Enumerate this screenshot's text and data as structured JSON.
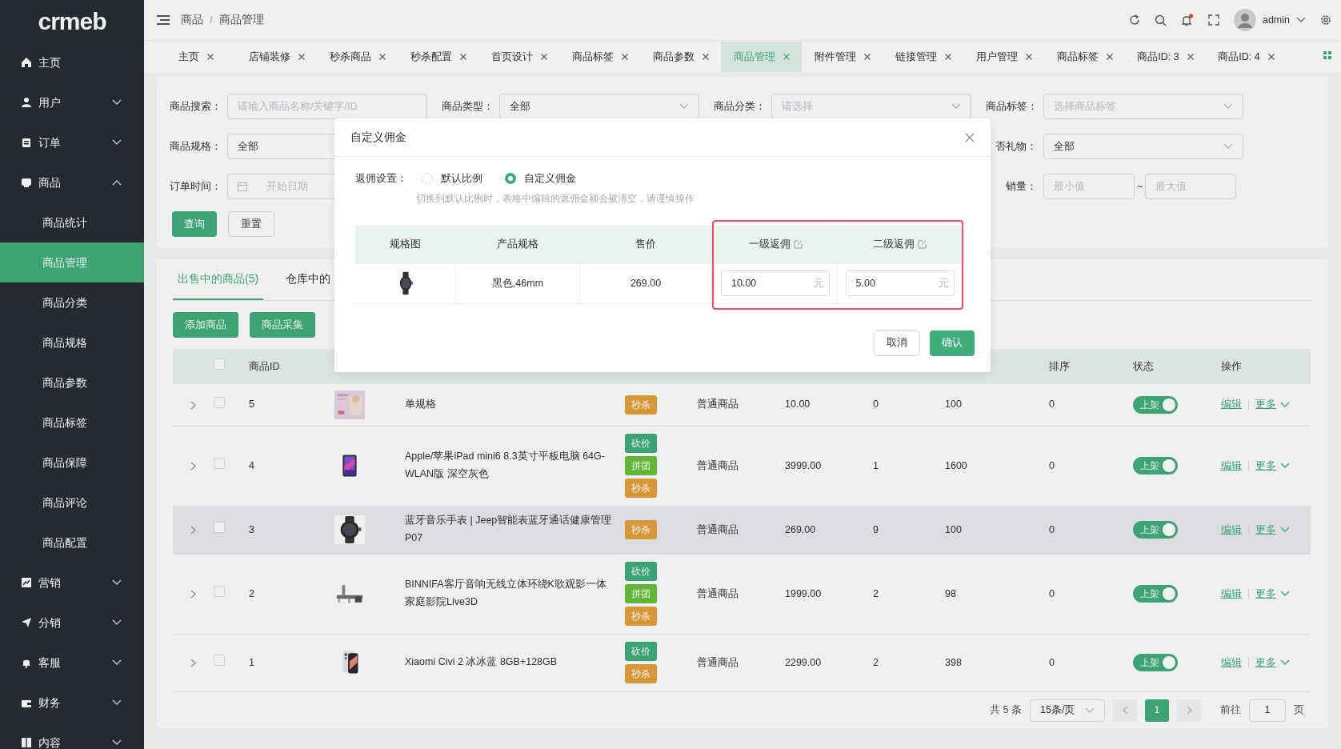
{
  "sidebar": {
    "logo": "crmeb",
    "items": [
      {
        "label": "主页"
      },
      {
        "label": "用户",
        "expanded": false
      },
      {
        "label": "订单",
        "expanded": false
      },
      {
        "label": "商品",
        "expanded": true,
        "children": [
          {
            "label": "商品统计",
            "selected": false
          },
          {
            "label": "商品管理",
            "selected": true
          },
          {
            "label": "商品分类",
            "selected": false
          },
          {
            "label": "商品规格",
            "selected": false
          },
          {
            "label": "商品参数",
            "selected": false
          },
          {
            "label": "商品标签",
            "selected": false
          },
          {
            "label": "商品保障",
            "selected": false
          },
          {
            "label": "商品评论",
            "selected": false
          },
          {
            "label": "商品配置",
            "selected": false
          }
        ]
      },
      {
        "label": "营销",
        "expanded": false
      },
      {
        "label": "分销",
        "expanded": false
      },
      {
        "label": "客服",
        "expanded": false
      },
      {
        "label": "财务",
        "expanded": false
      },
      {
        "label": "内容",
        "expanded": false
      }
    ]
  },
  "header": {
    "breadcrumb": [
      "商品",
      "商品管理"
    ],
    "separator": "/",
    "user": "admin",
    "notification": true
  },
  "tabs": [
    {
      "label": "主页",
      "selected": false
    },
    {
      "label": "店铺装修",
      "selected": false
    },
    {
      "label": "秒杀商品",
      "selected": false
    },
    {
      "label": "秒杀配置",
      "selected": false
    },
    {
      "label": "首页设计",
      "selected": false
    },
    {
      "label": "商品标签",
      "selected": false
    },
    {
      "label": "商品参数",
      "selected": false
    },
    {
      "label": "商品管理",
      "selected": true
    },
    {
      "label": "附件管理",
      "selected": false
    },
    {
      "label": "链接管理",
      "selected": false
    },
    {
      "label": "用户管理",
      "selected": false
    },
    {
      "label": "商品标签",
      "selected": false
    },
    {
      "label": "商品ID: 3",
      "selected": false
    },
    {
      "label": "商品ID: 4",
      "selected": false
    }
  ],
  "filters": {
    "rows": [
      [
        {
          "label": "商品搜索：",
          "kind": "input",
          "placeholder": "请输入商品名称/关键字/ID"
        },
        {
          "label": "商品类型：",
          "kind": "select",
          "value": "全部"
        },
        {
          "label": "商品分类：",
          "kind": "select",
          "placeholder": "请选择"
        },
        {
          "label": "商品标签：",
          "kind": "select",
          "placeholder": "选择商品标签"
        }
      ],
      [
        {
          "label": "商品规格：",
          "kind": "input",
          "value": "全部"
        },
        {
          "kind": "blank"
        },
        {
          "kind": "blank"
        },
        {
          "label": "否礼物：",
          "kind": "select",
          "value": "全部"
        }
      ],
      [
        {
          "label": "订单时间：",
          "kind": "date",
          "placeholder": "开始日期"
        },
        {
          "kind": "blank"
        },
        {
          "kind": "blank"
        },
        {
          "label": "销量：",
          "kind": "range",
          "placeholder": "最小值",
          "placeholder_2": "最大值",
          "separator": "~"
        }
      ]
    ],
    "buttons": [
      "查询",
      "重置"
    ]
  },
  "list": {
    "tabs": [
      {
        "label": "出售中的商品(5)",
        "selected": true
      },
      {
        "label": "仓库中的",
        "selected": false
      }
    ],
    "buttons": [
      "添加商品",
      "商品采集"
    ],
    "select_all_checked": false,
    "columns": [
      "",
      "",
      "商品ID",
      "",
      "",
      "",
      "",
      "",
      "",
      "",
      "排序",
      "状态",
      "操作"
    ],
    "rows": [
      {
        "id": "5",
        "name": "单规格",
        "tags": [
          {
            "label": "秒杀",
            "color": "#e6a23c"
          }
        ],
        "type": "普通商品",
        "price": "10.00",
        "sales": "0",
        "stock": "100",
        "sort": "0",
        "status": {
          "label": "上架",
          "on": true
        },
        "actions": [
          "编辑",
          "更多"
        ],
        "selected": false,
        "checked": false
      },
      {
        "id": "4",
        "name": "Apple/苹果iPad mini6 8.3英寸平板电脑 64G-WLAN版 深空灰色",
        "tags": [
          {
            "label": "砍价",
            "color": "#3fae7c"
          },
          {
            "label": "拼团",
            "color": "#67c23a"
          },
          {
            "label": "秒杀",
            "color": "#e6a23c"
          }
        ],
        "type": "普通商品",
        "price": "3999.00",
        "sales": "1",
        "stock": "1600",
        "sort": "0",
        "status": {
          "label": "上架",
          "on": true
        },
        "actions": [
          "编辑",
          "更多"
        ],
        "selected": false,
        "checked": false
      },
      {
        "id": "3",
        "name": "蓝牙音乐手表 | Jeep智能表蓝牙通话健康管理 P07",
        "tags": [
          {
            "label": "秒杀",
            "color": "#e6a23c"
          }
        ],
        "type": "普通商品",
        "price": "269.00",
        "sales": "9",
        "stock": "100",
        "sort": "0",
        "status": {
          "label": "上架",
          "on": true
        },
        "actions": [
          "编辑",
          "更多"
        ],
        "selected": true,
        "checked": false
      },
      {
        "id": "2",
        "name": "BINNIFA客厅音响无线立体环绕K歌观影一体家庭影院Live3D",
        "tags": [
          {
            "label": "砍价",
            "color": "#3fae7c"
          },
          {
            "label": "拼团",
            "color": "#67c23a"
          },
          {
            "label": "秒杀",
            "color": "#e6a23c"
          }
        ],
        "type": "普通商品",
        "price": "1999.00",
        "sales": "2",
        "stock": "98",
        "sort": "0",
        "status": {
          "label": "上架",
          "on": true
        },
        "actions": [
          "编辑",
          "更多"
        ],
        "selected": false,
        "checked": false
      },
      {
        "id": "1",
        "name": "Xiaomi Civi 2 冰冰蓝 8GB+128GB",
        "tags": [
          {
            "label": "砍价",
            "color": "#3fae7c"
          },
          {
            "label": "秒杀",
            "color": "#e6a23c"
          }
        ],
        "type": "普通商品",
        "price": "2299.00",
        "sales": "2",
        "stock": "398",
        "sort": "0",
        "status": {
          "label": "上架",
          "on": true
        },
        "actions": [
          "编辑",
          "更多"
        ],
        "selected": false,
        "checked": false
      }
    ],
    "pagination": {
      "total": "共 5 条",
      "page_size": "15条/页",
      "pages": [
        {
          "label": "1",
          "selected": true
        }
      ],
      "goto": "前往",
      "goto_value": "1",
      "goto_suffix": "页"
    }
  },
  "modal": {
    "title": "自定义佣金",
    "setting_label": "返佣设置：",
    "options": [
      {
        "label": "默认比例",
        "selected": false
      },
      {
        "label": "自定义佣金",
        "selected": true
      }
    ],
    "hint": "切换到默认比例时，表格中编辑的返佣金额会被清空，请谨慎操作",
    "columns": [
      "规格图",
      "产品规格",
      "售价",
      "一级返佣",
      "二级返佣"
    ],
    "rows": [
      {
        "spec": "黑色,46mm",
        "price": "269.00",
        "level_1": "10.00",
        "level_2": "5.00",
        "unit": "元",
        "unit_2": "元"
      }
    ],
    "highlighted_columns": true,
    "buttons": [
      "取消",
      "确认"
    ]
  }
}
